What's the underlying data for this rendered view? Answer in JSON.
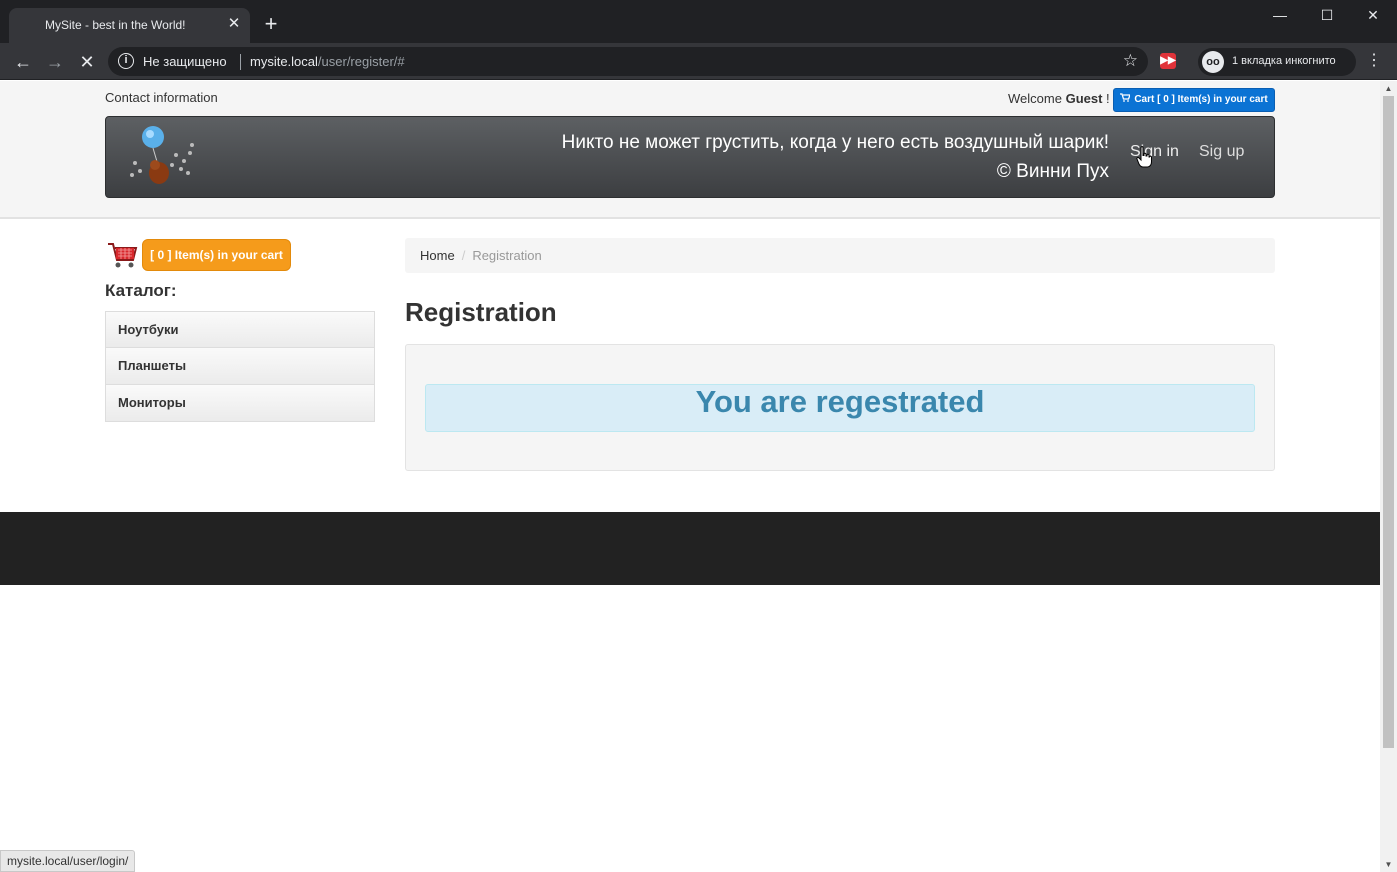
{
  "browser": {
    "tab_title": "MySite - best in the World!",
    "tab_close": "✕",
    "new_tab": "+",
    "win_min": "—",
    "win_max": "☐",
    "win_close": "✕",
    "back": "←",
    "forward": "→",
    "reload": "✕",
    "info": "i",
    "security": "Не защищено",
    "url_host": "mysite.local",
    "url_path": "/user/register/#",
    "star": "☆",
    "incognito_label": "1 вкладка инкогнито",
    "menu": "⋮"
  },
  "header": {
    "contact": "Contact information",
    "welcome_prefix": "Welcome",
    "welcome_user": "Guest",
    "welcome_suffix": "!",
    "cart_button": "Cart [ 0 ] Item(s) in your cart",
    "quote_line1": "Никто не может грустить, когда у него есть воздушный шарик!",
    "quote_line2": "© Винни Пух",
    "sign_in": "Sign in",
    "sign_up": "Sig up"
  },
  "sidebar": {
    "cart_button": "[ 0 ] Item(s) in your cart",
    "catalog_title": "Каталог:",
    "items": [
      {
        "label": "Ноутбуки"
      },
      {
        "label": "Планшеты"
      },
      {
        "label": "Мониторы"
      }
    ]
  },
  "main": {
    "breadcrumb_home": "Home",
    "breadcrumb_sep": "/",
    "breadcrumb_current": "Registration",
    "title": "Registration",
    "alert": "You are regestrated"
  },
  "status_bar": "mysite.local/user/login/",
  "colors": {
    "cart_top": "#0b73d4",
    "cart_side": "#f59b1b",
    "alert_text": "#3a87ad",
    "footer": "#222222"
  }
}
